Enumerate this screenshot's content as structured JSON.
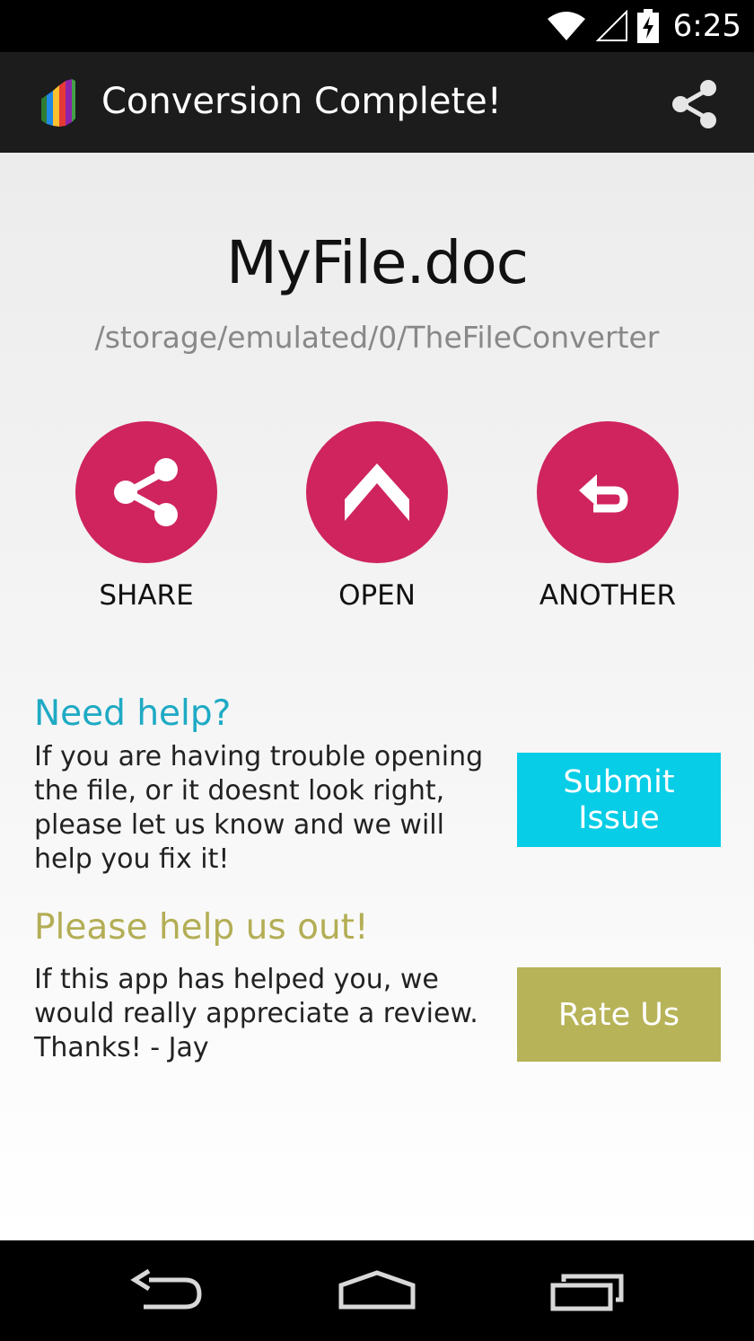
{
  "status_bar": {
    "time": "6:25",
    "icons": [
      "wifi-icon",
      "signal-icon",
      "battery-charging-icon"
    ]
  },
  "action_bar": {
    "title": "Conversion Complete!",
    "logo_icon": "app-logo-icon",
    "share_icon": "share-icon"
  },
  "file": {
    "name": "MyFile.doc",
    "path": "/storage/emulated/0/TheFileConverter"
  },
  "actions": [
    {
      "label": "SHARE",
      "icon": "share-icon"
    },
    {
      "label": "OPEN",
      "icon": "chevron-up-icon"
    },
    {
      "label": "ANOTHER",
      "icon": "undo-icon"
    }
  ],
  "help": {
    "title": "Need help?",
    "text": "If you are having trouble opening the file, or it doesnt look right, please let us know and we will help you fix it!",
    "button_label": "Submit Issue"
  },
  "rate": {
    "title": "Please help us out!",
    "text": "If this app has helped you, we would really appreciate a review. Thanks! - Jay",
    "button_label": "Rate Us"
  },
  "colors": {
    "action_circle": "#cf245d",
    "help_title": "#1eaac4",
    "submit_button": "#08cde6",
    "rate_title": "#b3ae55",
    "rate_button": "#b7b358"
  },
  "nav_bar": {
    "icons": [
      "back-icon",
      "home-icon",
      "recents-icon"
    ]
  }
}
